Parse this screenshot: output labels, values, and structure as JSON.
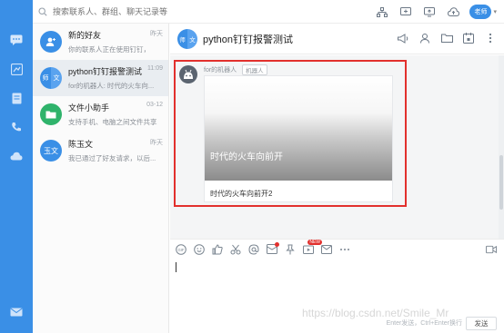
{
  "search": {
    "placeholder": "搜索联系人、群组、聊天记录等"
  },
  "topbar": {
    "user_badge": "老师",
    "icons": [
      "org-chart-icon",
      "new-chat-icon",
      "screen-share-icon",
      "cloud-upload-icon"
    ]
  },
  "rail": {
    "icons": [
      "chat-icon",
      "workbench-icon",
      "document-icon",
      "phone-icon",
      "cloud-icon",
      "mail-icon"
    ]
  },
  "conversations": [
    {
      "name": "新的好友",
      "preview": "你的联系人正在使用钉钉，",
      "time": "昨天",
      "avatar_color": "#3a8fe6",
      "avatar_icon": "person-add-icon"
    },
    {
      "name": "python钉钉报警测试",
      "preview": "for的机器人: 时代的火车向...",
      "time": "11:09",
      "avatar_left": "师",
      "avatar_right": "文",
      "active": true
    },
    {
      "name": "文件小助手",
      "preview": "支持手机、电脑之间文件共享",
      "time": "03-12",
      "avatar_color": "#2fb36b",
      "avatar_icon": "folder-icon"
    },
    {
      "name": "陈玉文",
      "preview": "我已通过了好友请求，以后...",
      "time": "昨天",
      "avatar_color": "#3a8fe6",
      "avatar_text": "玉文"
    }
  ],
  "chat": {
    "title": "python钉钉报警测试",
    "avatar_left": "师",
    "avatar_right": "文",
    "header_icons": [
      "announcement-icon",
      "member-icon",
      "folder-icon",
      "calendar-icon",
      "more-icon"
    ],
    "message": {
      "sender": "for的机器人",
      "tag": "机器人",
      "image_caption": "时代的火车向前开",
      "link_title": "时代的火车向前开2"
    },
    "composer_icons": [
      "gif-icon",
      "emoji-icon",
      "at-mention-icon",
      "scissors-icon",
      "at-icon",
      "red-packet-icon",
      "pin-icon",
      "live-icon",
      "mail-icon",
      "more-icon"
    ],
    "new_badge": "NEW",
    "send_hint": "Enter发送，Ctrl+Enter换行",
    "send_label": "发送"
  },
  "watermark": "https://blog.csdn.net/Smile_Mr"
}
